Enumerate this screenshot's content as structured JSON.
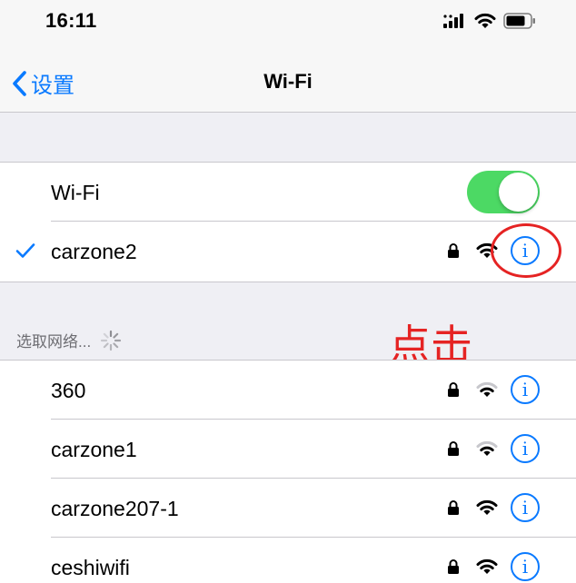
{
  "status_bar": {
    "time": "16:11"
  },
  "nav": {
    "back_label": "设置",
    "title": "Wi-Fi"
  },
  "wifi_toggle": {
    "label": "Wi-Fi",
    "on": true
  },
  "connected_network": {
    "name": "carzone2",
    "secured": true
  },
  "section_header": "选取网络...",
  "networks": [
    {
      "name": "360",
      "secured": true
    },
    {
      "name": "carzone1",
      "secured": true
    },
    {
      "name": "carzone207-1",
      "secured": true
    },
    {
      "name": "ceshiwifi",
      "secured": true
    }
  ],
  "annotation": {
    "text": "点击",
    "color": "#e52323"
  },
  "colors": {
    "accent": "#0a7aff",
    "toggle_on": "#4cd964",
    "background": "#efeff4"
  },
  "icons": {
    "info": "info-icon",
    "lock": "lock-icon",
    "wifi": "wifi-signal-icon",
    "check": "checkmark-icon"
  }
}
